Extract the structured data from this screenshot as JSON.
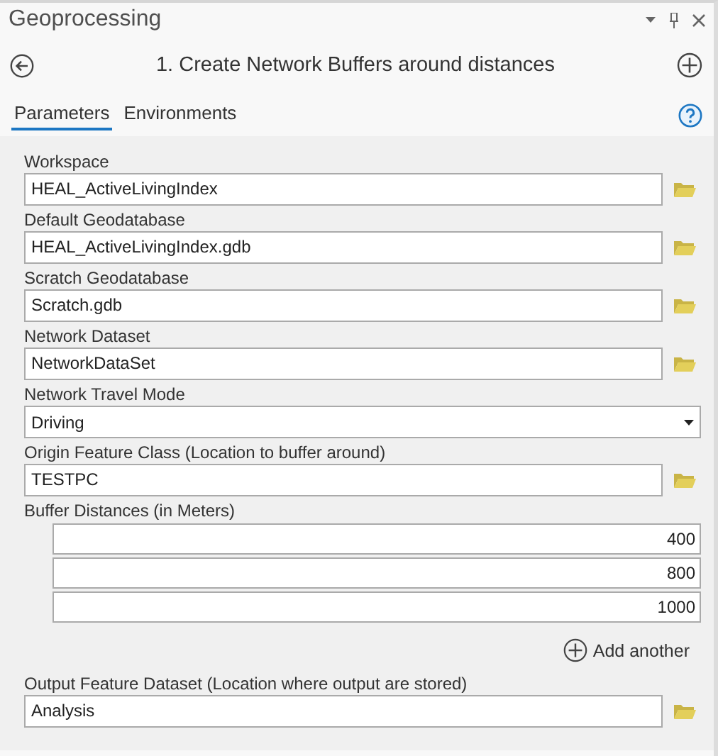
{
  "window": {
    "title": "Geoprocessing"
  },
  "tool": {
    "title": "1. Create Network Buffers around distances"
  },
  "tabs": [
    {
      "label": "Parameters",
      "selected": true
    },
    {
      "label": "Environments",
      "selected": false
    }
  ],
  "parameters": [
    {
      "kind": "path",
      "label": "Workspace",
      "value": "HEAL_ActiveLivingIndex"
    },
    {
      "kind": "path",
      "label": "Default Geodatabase",
      "value": "HEAL_ActiveLivingIndex.gdb"
    },
    {
      "kind": "path",
      "label": "Scratch Geodatabase",
      "value": "Scratch.gdb"
    },
    {
      "kind": "path",
      "label": "Network Dataset",
      "value": "NetworkDataSet"
    },
    {
      "kind": "dropdown",
      "label": "Network Travel Mode",
      "value": "Driving"
    },
    {
      "kind": "path",
      "label": "Origin Feature Class (Location to buffer around)",
      "value": "TESTPC"
    },
    {
      "kind": "multi",
      "label": "Buffer Distances (in Meters)",
      "values": [
        "400",
        "800",
        "1000"
      ],
      "add_label": "Add another"
    },
    {
      "kind": "path",
      "label": "Output Feature Dataset (Location where output are stored)",
      "value": "Analysis"
    }
  ]
}
